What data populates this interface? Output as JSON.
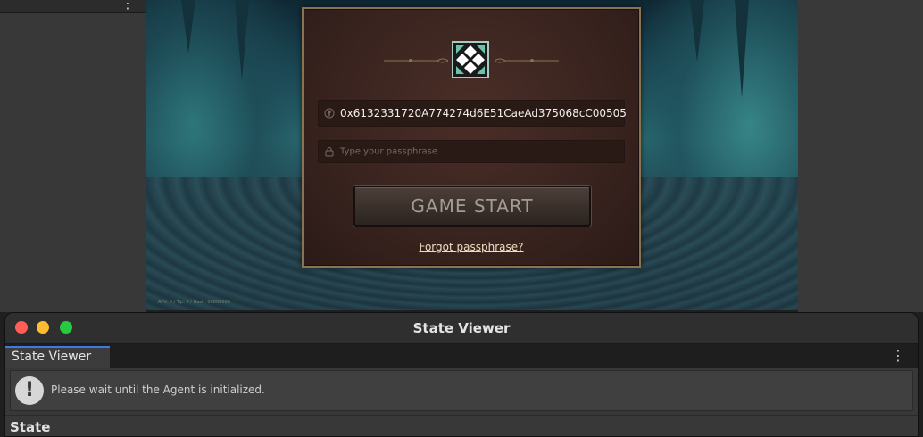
{
  "editor": {
    "left_menu_icon": "kebab-icon",
    "left_edge_mark": "⊃"
  },
  "game": {
    "hud_text": "APV: 0 / Tip: 0 / Hash: 00000000",
    "login": {
      "logo_icon": "game-logo-icon",
      "address_icon": "key-icon",
      "address_value": "0x6132331720A774274d6E51CaeAd375068cC00505",
      "passphrase_icon": "lock-icon",
      "passphrase_placeholder": "Type your passphrase",
      "start_label": "GAME START",
      "forgot_label": "Forgot passphrase?"
    }
  },
  "state_viewer": {
    "window_title": "State Viewer",
    "tab_label": "State Viewer",
    "menu_icon": "kebab-icon",
    "notice_icon": "warning-icon",
    "notice_text": "Please wait until the Agent is initialized.",
    "section_label": "State"
  },
  "colors": {
    "dialog_border": "#8a7352",
    "tab_accent": "#3d7be0",
    "traffic_red": "#fe5f57",
    "traffic_yellow": "#febc2e",
    "traffic_green": "#28c840"
  }
}
